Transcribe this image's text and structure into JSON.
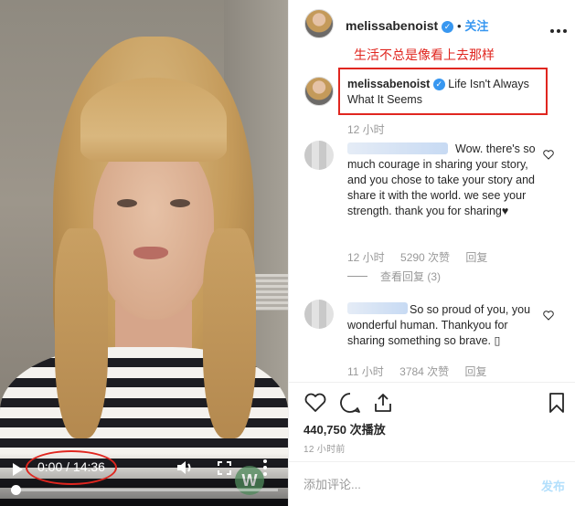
{
  "video": {
    "time_display": "0:00 / 14:36",
    "progress_fraction": 0.0,
    "watermark": "W"
  },
  "post": {
    "username": "melissabenoist",
    "verified_glyph": "✓",
    "dot": "•",
    "follow_label": "关注",
    "annotation": "生活不总是像看上去那样",
    "caption_text": "Life Isn't Always What It Seems",
    "caption_time": "12 小时"
  },
  "comments": [
    {
      "text": "Wow. there's so much courage in sharing your story, and you chose to take your story and share it with the world. we see your strength. thank you for sharing♥",
      "time": "12 小时",
      "likes": "5290 次赞",
      "reply_label": "回复",
      "view_replies": "查看回复 (3)"
    },
    {
      "text": "So so proud of you, you wonderful human. Thankyou for sharing something so brave. ▯",
      "time": "11 小时",
      "likes": "3784 次赞",
      "reply_label": "回复"
    }
  ],
  "stats": {
    "views": "440,750 次播放",
    "time_ago": "12 小时前"
  },
  "comment_box": {
    "placeholder": "添加评论...",
    "post_label": "发布"
  },
  "icons": [
    "play-icon",
    "volume-icon",
    "fullscreen-icon",
    "more-vertical-icon",
    "more-horizontal-icon",
    "verified-icon",
    "heart-icon",
    "comment-icon",
    "share-icon",
    "bookmark-icon"
  ],
  "colors": {
    "accent": "#3897f0",
    "annotation_red": "#e0261f",
    "muted": "#999999"
  }
}
